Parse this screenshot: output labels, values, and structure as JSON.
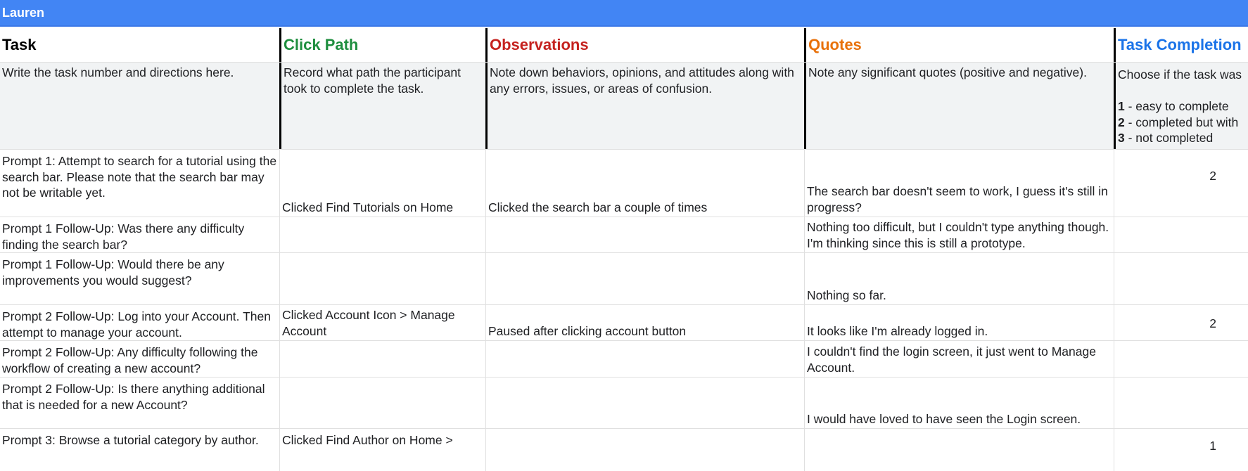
{
  "sheet": {
    "title": "Lauren"
  },
  "headers": {
    "task": "Task",
    "click_path": "Click Path",
    "observations": "Observations",
    "quotes": "Quotes",
    "task_completion": "Task Completion"
  },
  "descriptions": {
    "task": "Write the task number and directions here.",
    "click_path": "Record what path the participant took to complete the task.",
    "observations": "Note down behaviors, opinions, and attitudes along with any errors, issues, or areas of confusion.",
    "quotes": "Note any significant quotes (positive and negative).",
    "task_completion_intro": "Choose if the task was",
    "legend": [
      {
        "num": "1",
        "text": " - easy to complete"
      },
      {
        "num": "2",
        "text": " - completed but with"
      },
      {
        "num": "3",
        "text": " - not completed"
      }
    ]
  },
  "rows": [
    {
      "task": "Prompt 1: Attempt to search for a tutorial using the search bar. Please note that the search bar may not be writable yet.",
      "click_path": "Clicked Find Tutorials on Home",
      "observations": "Clicked the search bar a couple of times",
      "quotes": "The search bar doesn't seem to work, I guess it's still in progress?",
      "completion": "2"
    },
    {
      "task": "Prompt 1 Follow-Up: Was there any difficulty finding the search bar?",
      "click_path": "",
      "observations": "",
      "quotes": "Nothing too difficult, but I couldn't type anything though. I'm thinking since this is still a prototype.",
      "completion": ""
    },
    {
      "task": "Prompt 1 Follow-Up: Would there be any improvements you would suggest?",
      "click_path": "",
      "observations": "",
      "quotes": "Nothing so far.",
      "completion": ""
    },
    {
      "task": "Prompt 2 Follow-Up: Log into your Account. Then attempt to manage your account.",
      "click_path": "Clicked Account Icon > Manage Account",
      "observations": "Paused after clicking account button",
      "quotes": "It looks like I'm already logged in.",
      "completion": "2"
    },
    {
      "task": "Prompt 2 Follow-Up: Any difficulty following the workflow of creating a new account?",
      "click_path": "",
      "observations": "",
      "quotes": "I couldn't find the login screen, it just went to Manage Account.",
      "completion": ""
    },
    {
      "task": "Prompt 2 Follow-Up: Is there anything additional that is needed for a new Account?",
      "click_path": "",
      "observations": "",
      "quotes": "I would have loved to have seen the Login screen.",
      "completion": ""
    },
    {
      "task": "Prompt 3: Browse a tutorial category by author.",
      "click_path": "Clicked Find Author on Home >",
      "observations": "",
      "quotes": "",
      "completion": "1"
    }
  ]
}
